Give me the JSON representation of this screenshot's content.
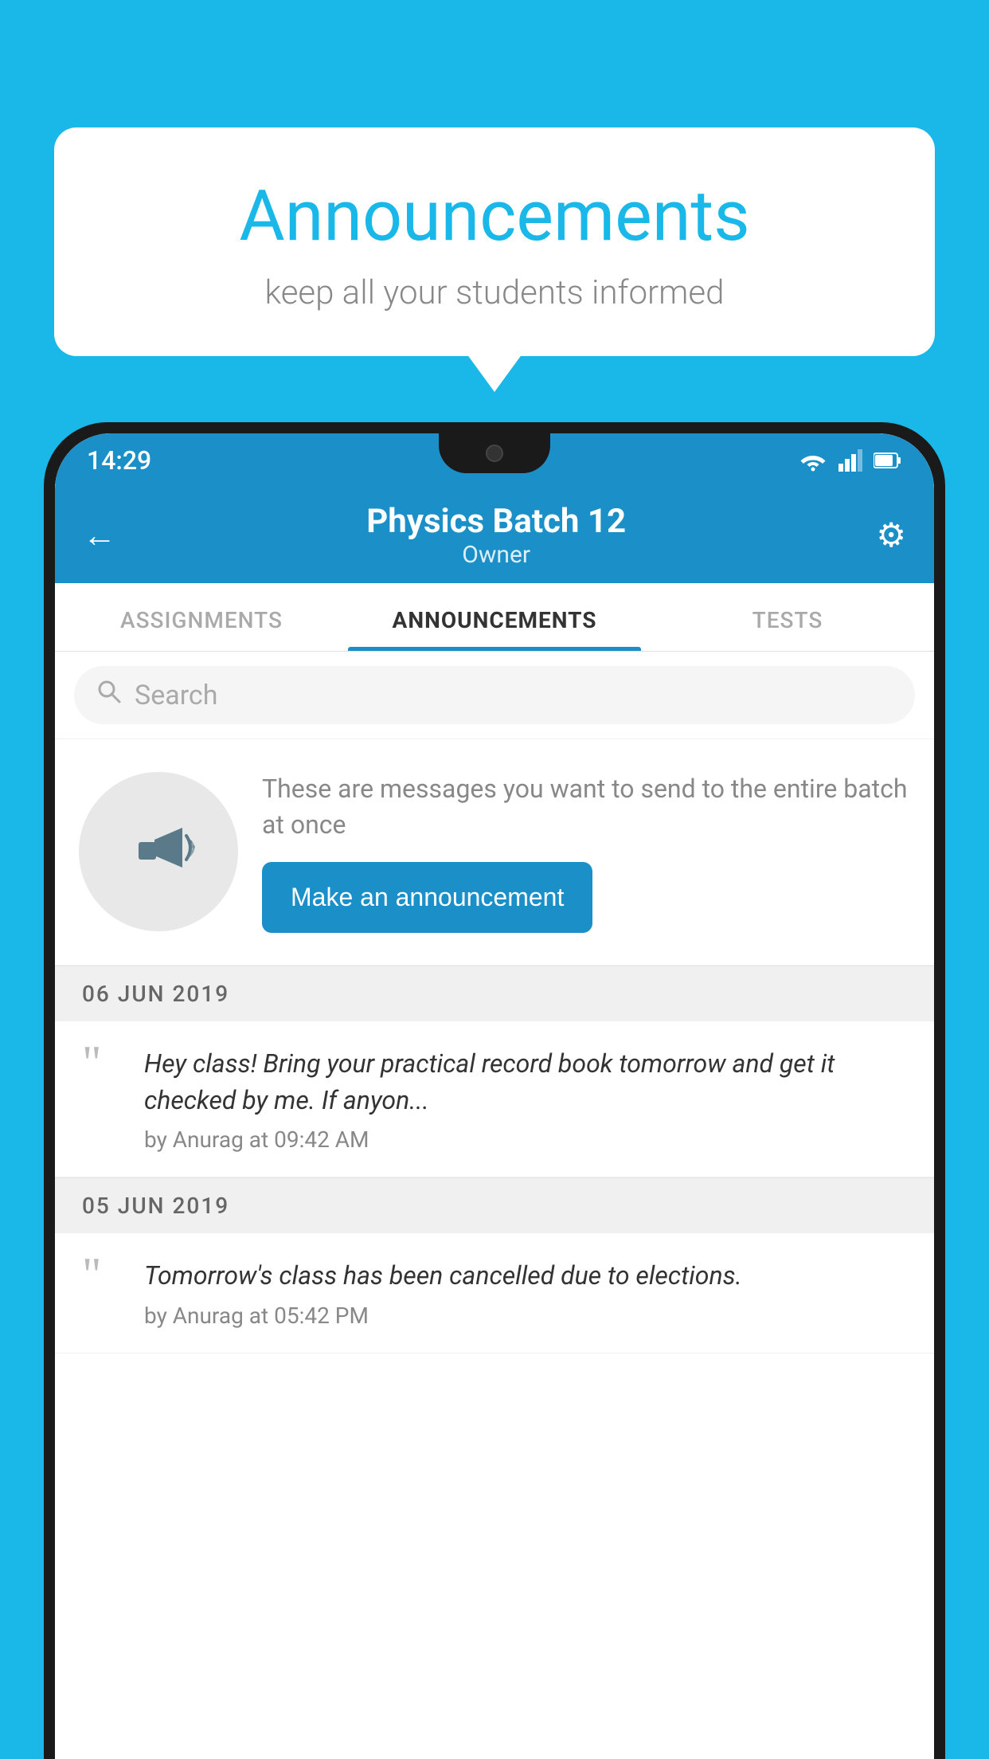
{
  "background_color": "#1ab8e8",
  "speech_bubble": {
    "title": "Announcements",
    "subtitle": "keep all your students informed"
  },
  "phone": {
    "status_bar": {
      "time": "14:29"
    },
    "header": {
      "title": "Physics Batch 12",
      "subtitle": "Owner",
      "back_label": "←",
      "settings_icon": "⚙"
    },
    "tabs": [
      {
        "label": "ASSIGNMENTS",
        "active": false
      },
      {
        "label": "ANNOUNCEMENTS",
        "active": true
      },
      {
        "label": "TESTS",
        "active": false
      }
    ],
    "search": {
      "placeholder": "Search"
    },
    "cta": {
      "description": "These are messages you want to send to the entire batch at once",
      "button_label": "Make an announcement"
    },
    "announcement_groups": [
      {
        "date": "06  JUN  2019",
        "items": [
          {
            "text": "Hey class! Bring your practical record book tomorrow and get it checked by me. If anyon...",
            "meta": "by Anurag at 09:42 AM"
          }
        ]
      },
      {
        "date": "05  JUN  2019",
        "items": [
          {
            "text": "Tomorrow's class has been cancelled due to elections.",
            "meta": "by Anurag at 05:42 PM"
          }
        ]
      }
    ]
  }
}
